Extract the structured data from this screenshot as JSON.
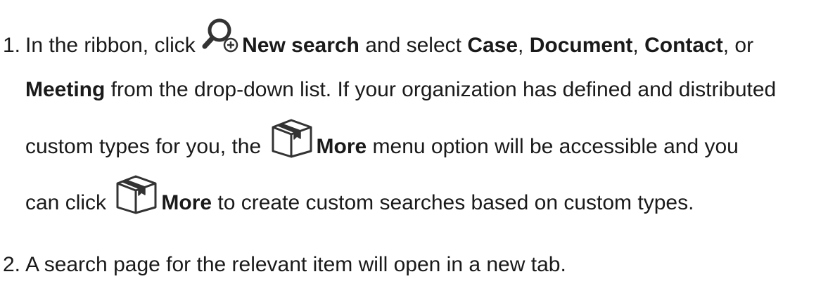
{
  "steps": [
    {
      "number": "1.",
      "line1": {
        "t1": "In the ribbon, click ",
        "icon": "search-add-icon",
        "b1": "New search",
        "t2": " and select ",
        "b2": "Case",
        "t3": ", ",
        "b3": "Document",
        "t4": ", ",
        "b4": "Contact",
        "t5": ", or"
      },
      "line2": {
        "b1": "Meeting",
        "t1": " from the drop-down list. If your organization has defined and distributed"
      },
      "line3": {
        "t1": "custom types for you, the ",
        "icon": "box-icon",
        "b1": "More",
        "t2": " menu option will be accessible and you"
      },
      "line4": {
        "t1": "can click ",
        "icon": "box-icon",
        "b1": "More",
        "t2": " to create custom searches based on custom types."
      }
    },
    {
      "number": "2.",
      "text": "A search page for the relevant item will open in a new tab."
    }
  ],
  "colors": {
    "text": "#1a1a1a",
    "icon_dark": "#333333",
    "icon_magnifier_fill": "#ffffff"
  }
}
